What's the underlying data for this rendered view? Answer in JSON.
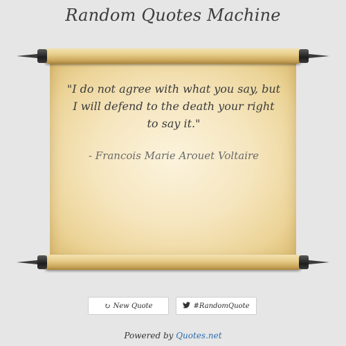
{
  "header": {
    "title": "Random Quotes Machine"
  },
  "quote": {
    "text": "\"I do not agree with what you say, but I will defend to the death your right to say it.\"",
    "author": "- Francois Marie Arouet Voltaire"
  },
  "buttons": {
    "new_quote": {
      "label": "New Quote",
      "icon": "refresh-icon"
    },
    "tweet": {
      "label": "#RandomQuote",
      "icon": "twitter-icon"
    }
  },
  "footer": {
    "prefix": "Powered by ",
    "link_text": "Quotes.net"
  },
  "colors": {
    "link": "#2b6cb0",
    "background": "#e6e6e6"
  }
}
